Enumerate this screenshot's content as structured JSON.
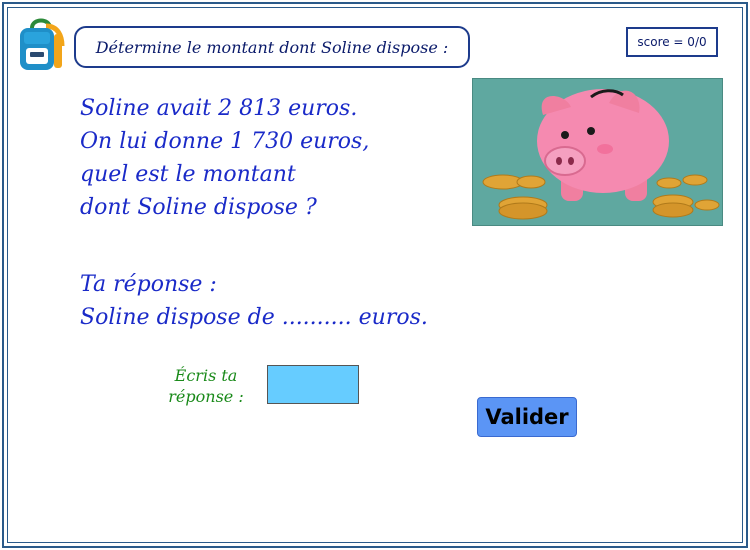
{
  "header": {
    "title": "Détermine le montant dont Soline dispose :",
    "score": "score = 0/0"
  },
  "problem": {
    "lines": [
      "Soline avait 2 813 euros.",
      "On lui donne 1 730 euros,",
      "quel est le montant",
      "dont Soline dispose ?"
    ]
  },
  "answer": {
    "lines": [
      "Ta réponse :",
      "Soline dispose de .......... euros."
    ]
  },
  "input": {
    "label_line1": "Écris ta",
    "label_line2": "réponse :",
    "value": ""
  },
  "actions": {
    "validate_label": "Valider"
  },
  "icons": {
    "backpack": "backpack-icon",
    "illustration": "piggy-bank-with-coins"
  },
  "colors": {
    "frame": "#2a5a8a",
    "problem_text": "#1a2ac8",
    "label_text": "#1a8a1a",
    "input_bg": "#66ccff",
    "button_bg": "#5b95f5",
    "illustration_bg": "#5fa8a0"
  }
}
